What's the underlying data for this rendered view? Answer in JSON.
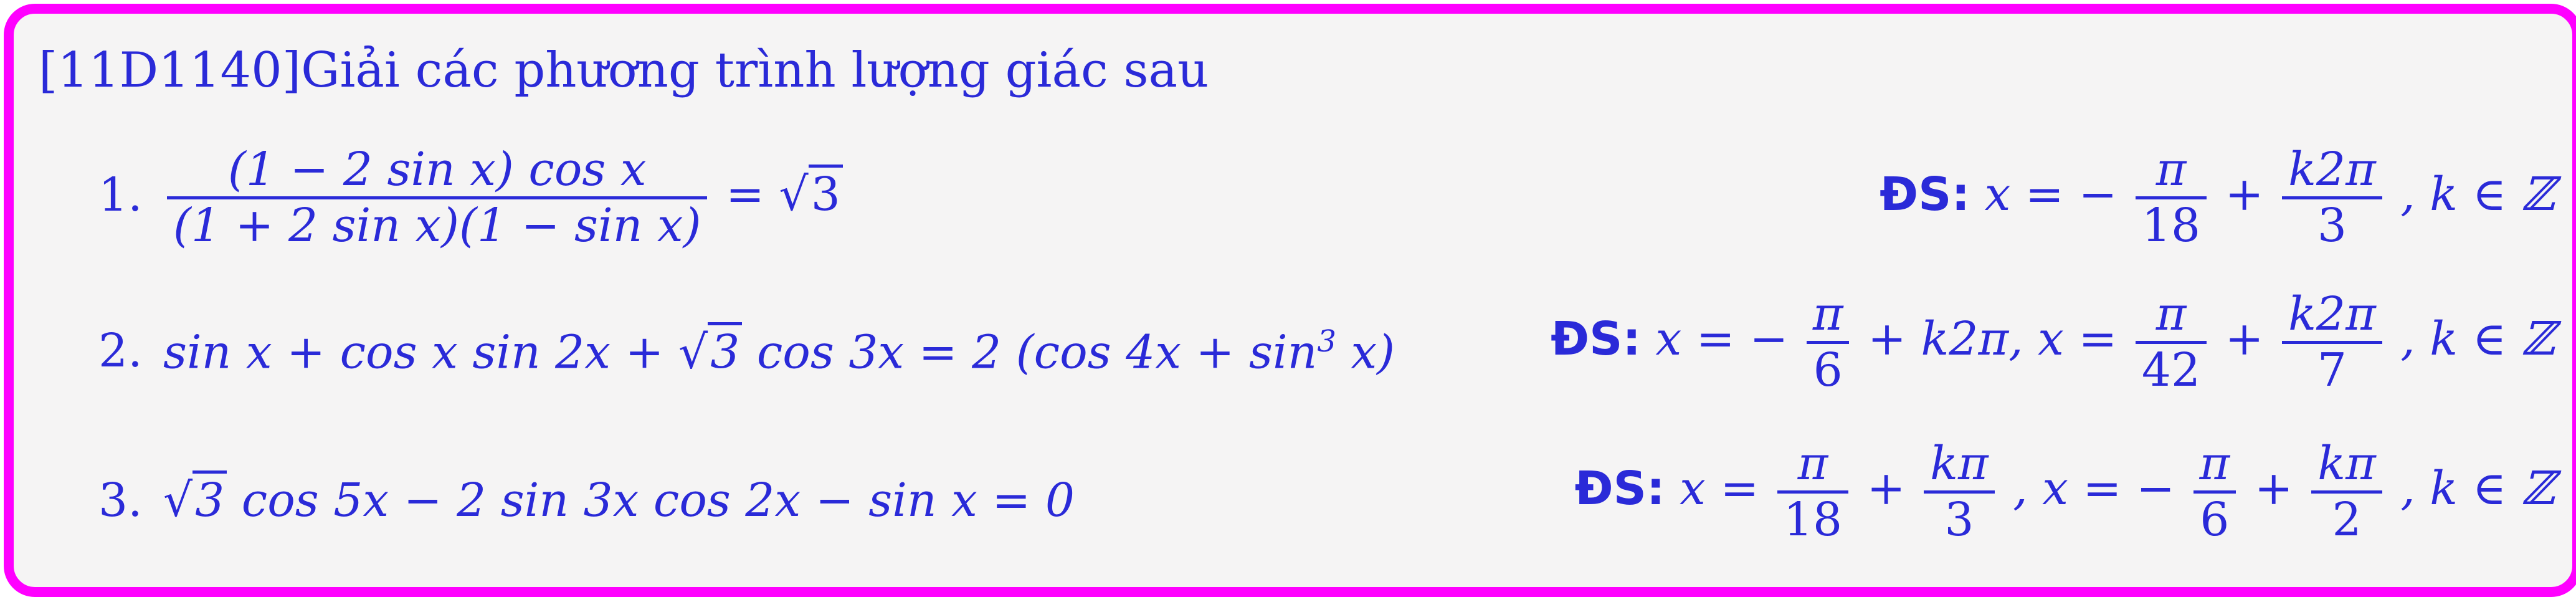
{
  "title": "[11D1140]Giải các phương trình lượng giác sau",
  "problems": [
    {
      "number": "1.",
      "lhs_numerator": "(1 − 2 sin x) cos x",
      "lhs_denominator": "(1 + 2 sin x)(1 − sin x)",
      "rhs_prefix": "= √",
      "rhs_radicand": "3",
      "answer_label": "ĐS:",
      "answer_prefix": "x = −",
      "answer_frac1_num": "π",
      "answer_frac1_den": "18",
      "answer_plus": "+",
      "answer_frac2_num": "k2π",
      "answer_frac2_den": "3",
      "answer_suffix": ", k ∈ ℤ"
    },
    {
      "number": "2.",
      "equation_part1": "sin x + cos x sin 2x + √",
      "equation_radicand": "3",
      "equation_part2": " cos 3x = 2 (cos 4x + sin",
      "equation_exp": "3",
      "equation_part3": " x)",
      "answer_label": "ĐS:",
      "answer_prefix": "x = −",
      "answer_frac1_num": "π",
      "answer_frac1_den": "6",
      "answer_mid": "+ k2π, x =",
      "answer_frac2_num": "π",
      "answer_frac2_den": "42",
      "answer_plus": "+",
      "answer_frac3_num": "k2π",
      "answer_frac3_den": "7",
      "answer_suffix": ", k ∈ ℤ"
    },
    {
      "number": "3.",
      "equation_prefix": "√",
      "equation_radicand": "3",
      "equation_rest": " cos 5x − 2 sin 3x cos 2x − sin x = 0",
      "answer_label": "ĐS:",
      "answer_prefix": "x =",
      "answer_frac1_num": "π",
      "answer_frac1_den": "18",
      "answer_plus1": "+",
      "answer_frac2_num": "kπ",
      "answer_frac2_den": "3",
      "answer_mid": ", x = −",
      "answer_frac3_num": "π",
      "answer_frac3_den": "6",
      "answer_plus2": "+",
      "answer_frac4_num": "kπ",
      "answer_frac4_den": "2",
      "answer_suffix": ", k ∈ ℤ"
    }
  ]
}
